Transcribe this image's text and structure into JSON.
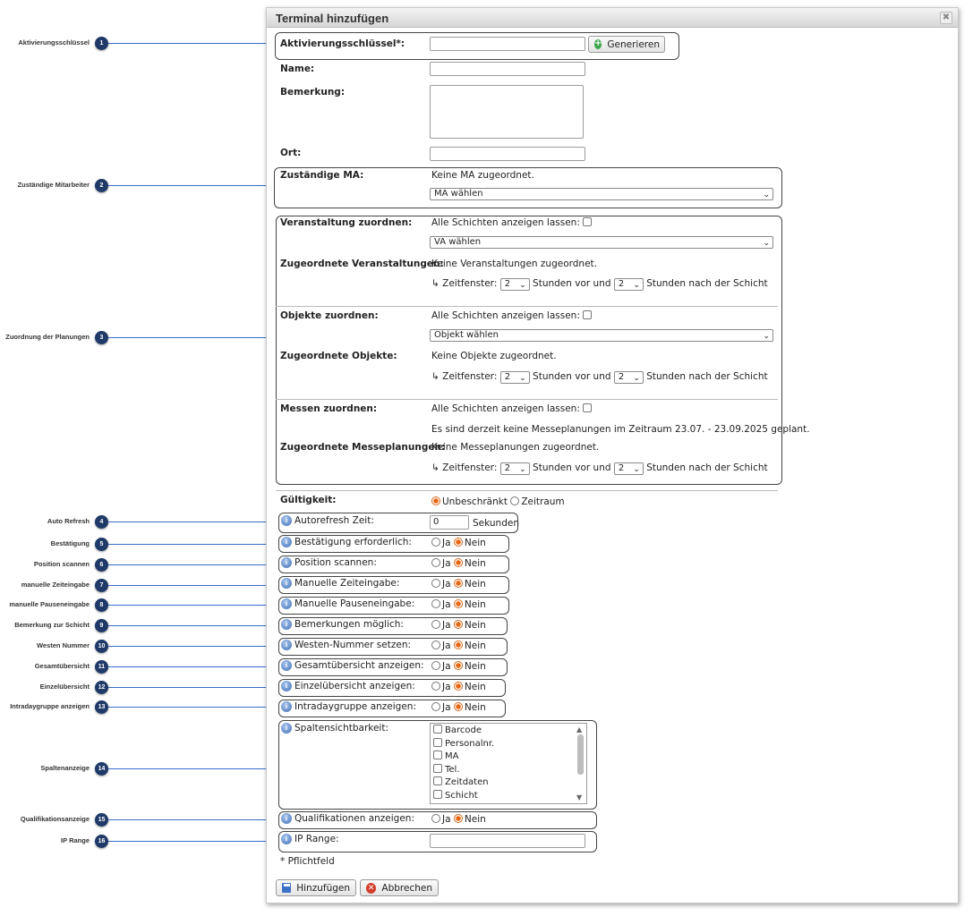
{
  "dialog": {
    "title": "Terminal hinzufügen",
    "close": "✖"
  },
  "callouts": [
    {
      "n": "1",
      "label": "Aktivierungsschlüssel"
    },
    {
      "n": "2",
      "label": "Zuständige Mitarbeiter"
    },
    {
      "n": "3",
      "label": "Zuordnung der Planungen"
    },
    {
      "n": "4",
      "label": "Auto Refresh"
    },
    {
      "n": "5",
      "label": "Bestätigung"
    },
    {
      "n": "6",
      "label": "Position scannen"
    },
    {
      "n": "7",
      "label": "manuelle Zeiteingabe"
    },
    {
      "n": "8",
      "label": "manuelle Pauseneingabe"
    },
    {
      "n": "9",
      "label": "Bemerkung zur Schicht"
    },
    {
      "n": "10",
      "label": "Westen Nummer"
    },
    {
      "n": "11",
      "label": "Gesamtübersicht"
    },
    {
      "n": "12",
      "label": "Einzelübersicht"
    },
    {
      "n": "13",
      "label": "Intradaygruppe anzeigen"
    },
    {
      "n": "14",
      "label": "Spaltenanzeige"
    },
    {
      "n": "15",
      "label": "Qualifikationsanzeige"
    },
    {
      "n": "16",
      "label": "IP Range"
    }
  ],
  "form": {
    "activation_label": "Aktivierungsschlüssel*:",
    "generate_label": "Generieren",
    "name_label": "Name:",
    "remark_label": "Bemerkung:",
    "location_label": "Ort:",
    "ma_label": "Zuständige MA:",
    "ma_none": "Keine MA zugeordnet.",
    "ma_select": "MA wählen",
    "va_label": "Veranstaltung zuordnen:",
    "show_all_shifts": "Alle Schichten anzeigen lassen:",
    "va_select": "VA wählen",
    "va_assigned_label": "Zugeordnete Veranstaltungen:",
    "va_none": "Keine Veranstaltungen zugeordnet.",
    "tw_prefix": "↳ Zeitfenster:",
    "tw_before_value": "2",
    "tw_mid": "Stunden vor und",
    "tw_after_value": "2",
    "tw_suffix": "Stunden nach der Schicht",
    "obj_label": "Objekte zuordnen:",
    "obj_select": "Objekt wählen",
    "obj_assigned_label": "Zugeordnete Objekte:",
    "obj_none": "Keine Objekte zugeordnet.",
    "fair_label": "Messen zuordnen:",
    "fair_notice": "Es sind derzeit keine Messeplanungen im Zeitraum 23.07. - 23.09.2025 geplant.",
    "fair_assigned_label": "Zugeordnete Messeplanungen:",
    "fair_none": "Keine Messeplanungen zugeordnet.",
    "validity_label": "Gültigkeit:",
    "validity_unlimited": "Unbeschränkt",
    "validity_period": "Zeitraum",
    "autorefresh_label": "Autorefresh Zeit:",
    "autorefresh_value": "0",
    "autorefresh_unit": "Sekunden",
    "yes": "Ja",
    "no": "Nein",
    "options": [
      "Bestätigung erforderlich:",
      "Position scannen:",
      "Manuelle Zeiteingabe:",
      "Manuelle Pauseneingabe:",
      "Bemerkungen möglich:",
      "Westen-Nummer setzen:",
      "Gesamtübersicht anzeigen:",
      "Einzelübersicht anzeigen:",
      "Intradaygruppe anzeigen:"
    ],
    "columns_label": "Spaltensichtbarkeit:",
    "columns": [
      "Barcode",
      "Personalnr.",
      "MA",
      "Tel.",
      "Zeitdaten",
      "Schicht"
    ],
    "qual_label": "Qualifikationen anzeigen:",
    "ip_label": "IP Range:",
    "required_note": "* Pflichtfeld",
    "add_button": "Hinzufügen",
    "cancel_button": "Abbrechen"
  },
  "colors": {
    "badge": "#1f3a68",
    "line": "#3a6cc8",
    "radio_on": "#e8660f"
  }
}
